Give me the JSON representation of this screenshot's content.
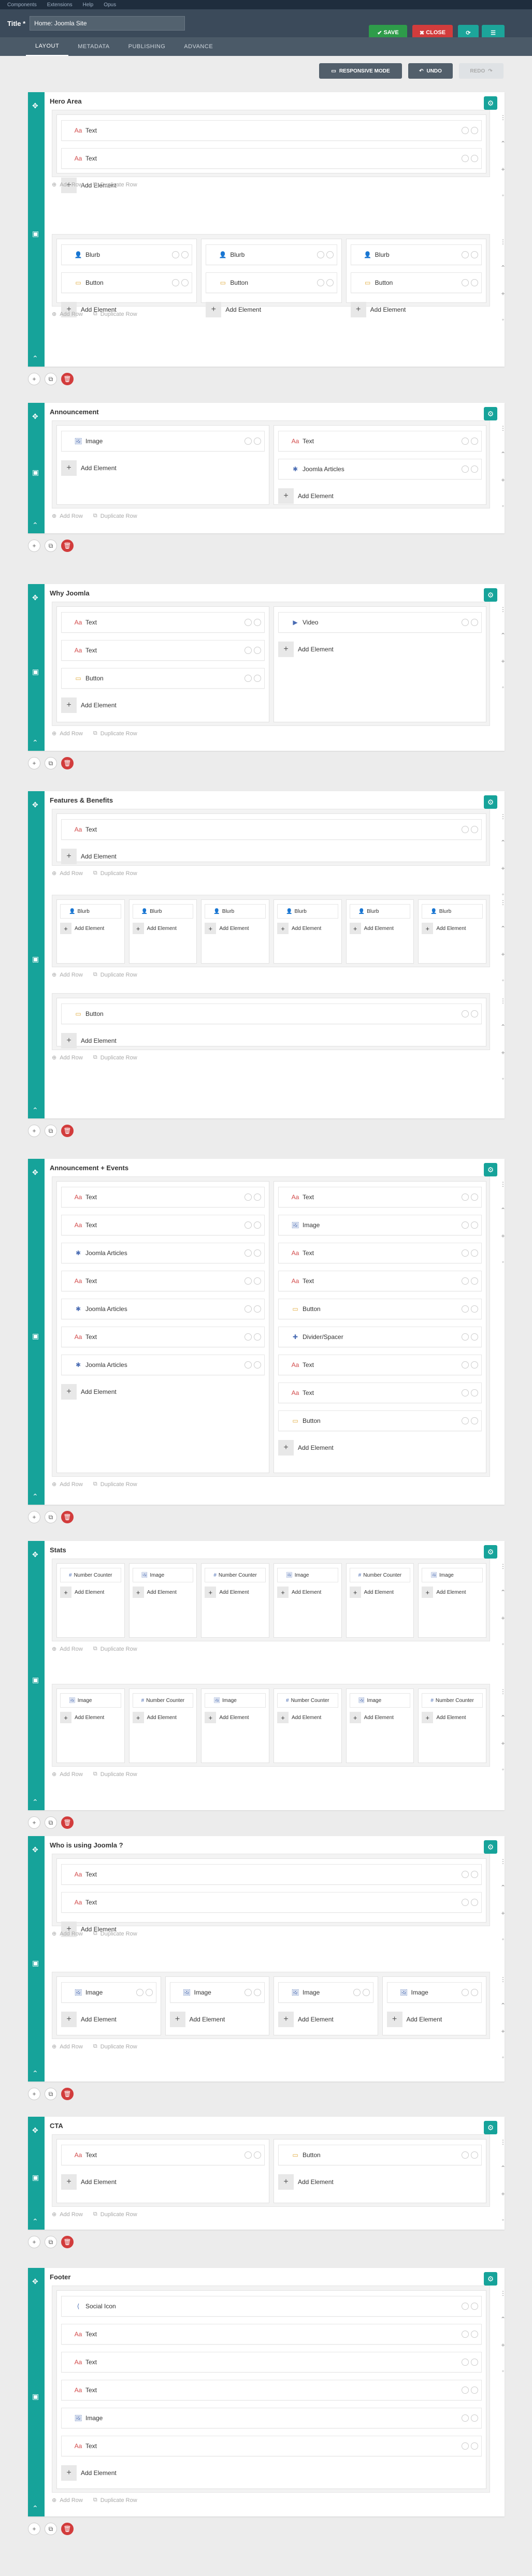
{
  "topbar": {
    "items": [
      "Components",
      "Extensions",
      "Help",
      "Opus"
    ]
  },
  "header": {
    "title_label": "Title *",
    "title_value": "Home: Joomla Site",
    "save": "SAVE",
    "close": "CLOSE"
  },
  "tabs": [
    "LAYOUT",
    "METADATA",
    "PUBLISHING",
    "ADVANCE"
  ],
  "toolbar": {
    "responsive": "RESPONSIVE MODE",
    "undo": "UNDO",
    "redo": "REDO"
  },
  "labels": {
    "add_element": "Add Element",
    "add_row": "Add Row",
    "duplicate_row": "Duplicate Row"
  },
  "sections": [
    {
      "title": "Hero Area"
    },
    {
      "title": "Announcement"
    },
    {
      "title": "Why Joomla"
    },
    {
      "title": "Features & Benefits"
    },
    {
      "title": "Announcement + Events"
    },
    {
      "title": "Stats"
    },
    {
      "title": "Who is using Joomla ?"
    },
    {
      "title": "CTA"
    },
    {
      "title": "Footer"
    }
  ],
  "elements": {
    "text": "Text",
    "blurb": "Blurb",
    "button": "Button",
    "image": "Image",
    "joomla_articles": "Joomla Articles",
    "video": "Video",
    "divider": "Divider/Spacer",
    "number_counter": "Number Counter",
    "social_icon": "Social Icon"
  },
  "hero_left_col": "Add Ele ment",
  "colors": {
    "accent": "#16a39a",
    "save": "#2e9c4a",
    "close": "#d23c3c",
    "header": "#3b4a5a"
  }
}
